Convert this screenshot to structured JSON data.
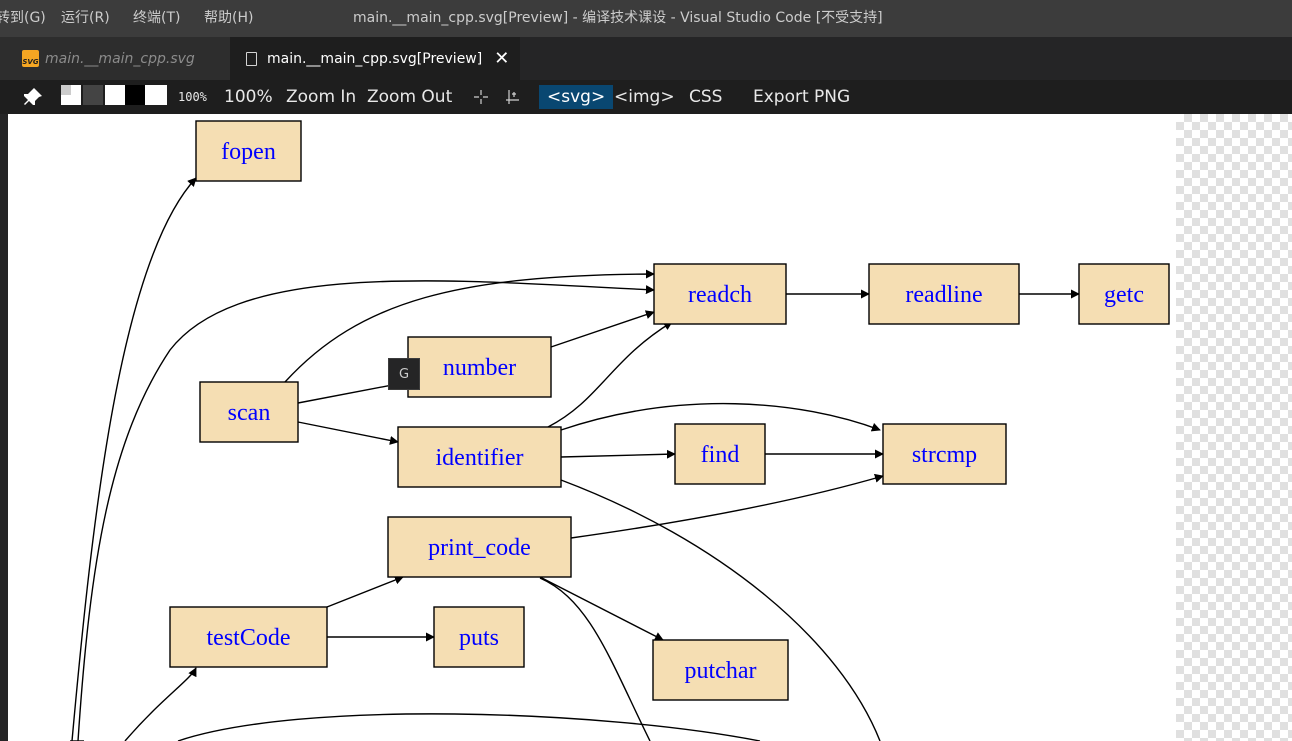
{
  "titlebar": {
    "menus": [
      "转到(G)",
      "运行(R)",
      "终端(T)",
      "帮助(H)"
    ],
    "window_title": "main.__main_cpp.svg[Preview] - 编译技术课设 - Visual Studio Code [不受支持]"
  },
  "tabs": [
    {
      "label": "main.__main_cpp.svg",
      "icon": "svg-file-icon",
      "active": false
    },
    {
      "label": "main.__main_cpp.svg[Preview]",
      "icon": "file-icon",
      "active": true,
      "close": "✕"
    }
  ],
  "toolbar": {
    "pin_icon": "pin-icon",
    "zoom_small": "100%",
    "zoom_100": "100%",
    "zoom_in": "Zoom In",
    "zoom_out": "Zoom Out",
    "crosshair_icon": "crosshair-icon",
    "ruler_icon": "ruler-icon",
    "svg_mode": "<svg>",
    "img_mode": "<img>",
    "css": "CSS",
    "export_png": "Export PNG"
  },
  "tooltip": {
    "label": "G"
  },
  "graph": {
    "nodes": [
      {
        "id": "fopen",
        "label": "fopen"
      },
      {
        "id": "readch",
        "label": "readch"
      },
      {
        "id": "readline",
        "label": "readline"
      },
      {
        "id": "getc",
        "label": "getc"
      },
      {
        "id": "number",
        "label": "number"
      },
      {
        "id": "scan",
        "label": "scan"
      },
      {
        "id": "identifier",
        "label": "identifier"
      },
      {
        "id": "find",
        "label": "find"
      },
      {
        "id": "strcmp",
        "label": "strcmp"
      },
      {
        "id": "print_code",
        "label": "print_code"
      },
      {
        "id": "testCode",
        "label": "testCode"
      },
      {
        "id": "puts",
        "label": "puts"
      },
      {
        "id": "putchar",
        "label": "putchar"
      }
    ],
    "edges": [
      [
        "readch",
        "readline"
      ],
      [
        "readline",
        "getc"
      ],
      [
        "number",
        "readch"
      ],
      [
        "scan",
        "readch"
      ],
      [
        "scan",
        "number"
      ],
      [
        "scan",
        "identifier"
      ],
      [
        "identifier",
        "readch"
      ],
      [
        "identifier",
        "find"
      ],
      [
        "identifier",
        "strcmp"
      ],
      [
        "find",
        "strcmp"
      ],
      [
        "print_code",
        "strcmp"
      ],
      [
        "print_code",
        "putchar"
      ],
      [
        "testCode",
        "print_code"
      ],
      [
        "testCode",
        "puts"
      ]
    ],
    "colors": {
      "node_fill": "#f5deb3",
      "node_text": "#0000ff",
      "edge": "#000000"
    }
  }
}
